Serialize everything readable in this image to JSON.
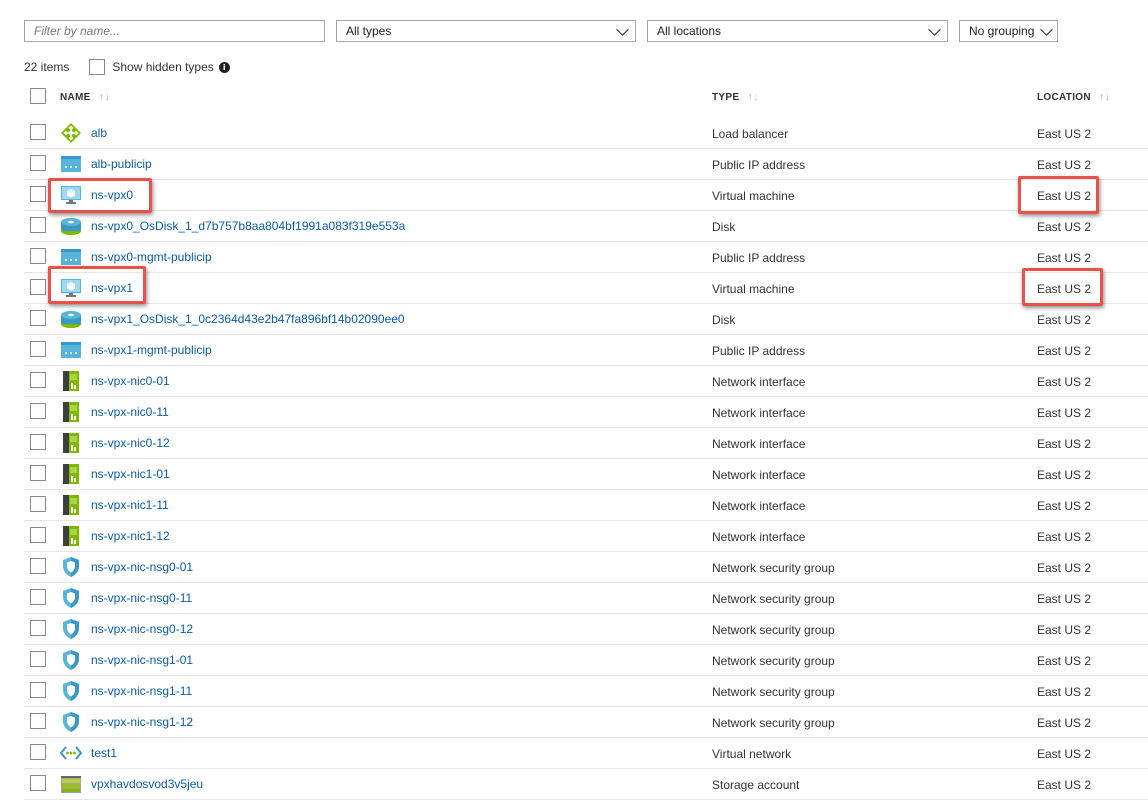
{
  "filters": {
    "name_placeholder": "Filter by name...",
    "types_label": "All types",
    "locations_label": "All locations",
    "grouping_label": "No grouping"
  },
  "summary": {
    "count": "22 items",
    "show_hidden_label": "Show hidden types"
  },
  "columns": {
    "name": "NAME",
    "type": "TYPE",
    "location": "LOCATION"
  },
  "rows": [
    {
      "name": "alb",
      "type": "Load balancer",
      "location": "East US 2",
      "icon": "load-balancer-icon"
    },
    {
      "name": "alb-publicip",
      "type": "Public IP address",
      "location": "East US 2",
      "icon": "public-ip-icon"
    },
    {
      "name": "ns-vpx0",
      "type": "Virtual machine",
      "location": "East US 2",
      "icon": "virtual-machine-icon"
    },
    {
      "name": "ns-vpx0_OsDisk_1_d7b757b8aa804bf1991a083f319e553a",
      "type": "Disk",
      "location": "East US 2",
      "icon": "disk-icon"
    },
    {
      "name": "ns-vpx0-mgmt-publicip",
      "type": "Public IP address",
      "location": "East US 2",
      "icon": "public-ip-icon"
    },
    {
      "name": "ns-vpx1",
      "type": "Virtual machine",
      "location": "East US 2",
      "icon": "virtual-machine-icon"
    },
    {
      "name": "ns-vpx1_OsDisk_1_0c2364d43e2b47fa896bf14b02090ee0",
      "type": "Disk",
      "location": "East US 2",
      "icon": "disk-icon"
    },
    {
      "name": "ns-vpx1-mgmt-publicip",
      "type": "Public IP address",
      "location": "East US 2",
      "icon": "public-ip-icon"
    },
    {
      "name": "ns-vpx-nic0-01",
      "type": "Network interface",
      "location": "East US 2",
      "icon": "network-interface-icon"
    },
    {
      "name": "ns-vpx-nic0-11",
      "type": "Network interface",
      "location": "East US 2",
      "icon": "network-interface-icon"
    },
    {
      "name": "ns-vpx-nic0-12",
      "type": "Network interface",
      "location": "East US 2",
      "icon": "network-interface-icon"
    },
    {
      "name": "ns-vpx-nic1-01",
      "type": "Network interface",
      "location": "East US 2",
      "icon": "network-interface-icon"
    },
    {
      "name": "ns-vpx-nic1-11",
      "type": "Network interface",
      "location": "East US 2",
      "icon": "network-interface-icon"
    },
    {
      "name": "ns-vpx-nic1-12",
      "type": "Network interface",
      "location": "East US 2",
      "icon": "network-interface-icon"
    },
    {
      "name": "ns-vpx-nic-nsg0-01",
      "type": "Network security group",
      "location": "East US 2",
      "icon": "network-security-group-icon"
    },
    {
      "name": "ns-vpx-nic-nsg0-11",
      "type": "Network security group",
      "location": "East US 2",
      "icon": "network-security-group-icon"
    },
    {
      "name": "ns-vpx-nic-nsg0-12",
      "type": "Network security group",
      "location": "East US 2",
      "icon": "network-security-group-icon"
    },
    {
      "name": "ns-vpx-nic-nsg1-01",
      "type": "Network security group",
      "location": "East US 2",
      "icon": "network-security-group-icon"
    },
    {
      "name": "ns-vpx-nic-nsg1-11",
      "type": "Network security group",
      "location": "East US 2",
      "icon": "network-security-group-icon"
    },
    {
      "name": "ns-vpx-nic-nsg1-12",
      "type": "Network security group",
      "location": "East US 2",
      "icon": "network-security-group-icon"
    },
    {
      "name": "test1",
      "type": "Virtual network",
      "location": "East US 2",
      "icon": "virtual-network-icon"
    },
    {
      "name": "vpxhavdosvod3v5jeu",
      "type": "Storage account",
      "location": "East US 2",
      "icon": "storage-account-icon"
    }
  ],
  "highlight_color": "#e8524a",
  "link_color": "#0a5ca8"
}
